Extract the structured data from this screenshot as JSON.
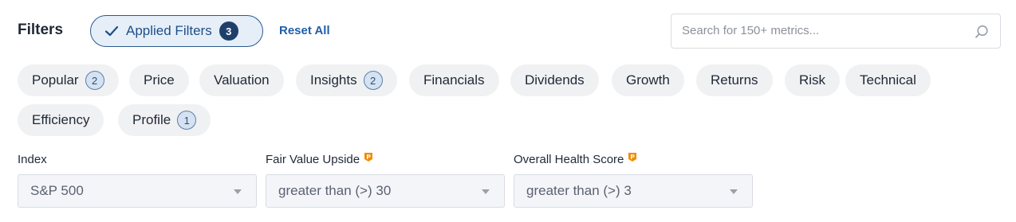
{
  "header": {
    "title": "Filters",
    "applied_filters": {
      "label": "Applied Filters",
      "count": "3"
    },
    "reset_label": "Reset All"
  },
  "search": {
    "placeholder": "Search for 150+ metrics...",
    "value": "",
    "icon": "search-icon"
  },
  "categories": [
    {
      "label": "Popular",
      "badge": "2"
    },
    {
      "label": "Price",
      "badge": null
    },
    {
      "label": "Valuation",
      "badge": null
    },
    {
      "label": "Insights",
      "badge": "2"
    },
    {
      "label": "Financials",
      "badge": null
    },
    {
      "label": "Dividends",
      "badge": null
    },
    {
      "label": "Growth",
      "badge": null
    },
    {
      "label": "Returns",
      "badge": null
    },
    {
      "label": "Risk",
      "badge": null
    },
    {
      "label": "Technical",
      "badge": null
    },
    {
      "label": "Efficiency",
      "badge": null
    },
    {
      "label": "Profile",
      "badge": "1"
    }
  ],
  "fields": [
    {
      "label": "Index",
      "pro": false,
      "value": "S&P 500"
    },
    {
      "label": "Fair Value Upside",
      "pro": true,
      "value": "greater than (>) 30"
    },
    {
      "label": "Overall Health Score",
      "pro": true,
      "value": "greater than (>) 3"
    }
  ],
  "colors": {
    "accent": "#1f4f86",
    "badge_dark": "#1f3f6b",
    "pro_icon": "#f08c00",
    "chip_bg": "#f0f1f3"
  }
}
